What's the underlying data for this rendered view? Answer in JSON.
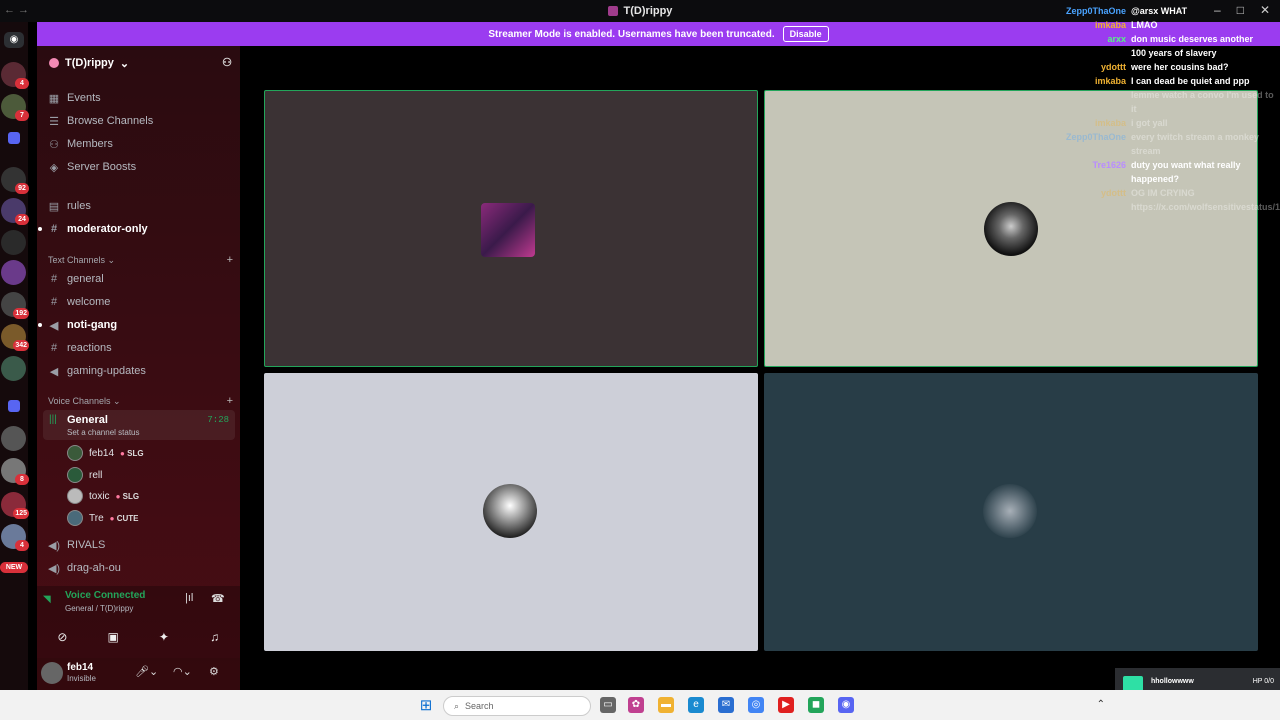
{
  "window": {
    "title": "T(D)rippy",
    "nav": "← →"
  },
  "banner": {
    "text": "Streamer Mode is enabled. Usernames have been truncated.",
    "disable_label": "Disable"
  },
  "guilds": {
    "badges": [
      "4",
      "7",
      "92",
      "24",
      "192",
      "342",
      "8",
      "125",
      "4"
    ],
    "new_label": "NEW"
  },
  "server": {
    "name": "T(D)rippy"
  },
  "nav": [
    {
      "label": "Events",
      "icon": "calendar-icon"
    },
    {
      "label": "Browse Channels",
      "icon": "browse-icon"
    },
    {
      "label": "Members",
      "icon": "members-icon"
    },
    {
      "label": "Server Boosts",
      "icon": "boost-icon"
    }
  ],
  "channels_top": [
    {
      "label": "rules",
      "icon": "#",
      "bold": false
    },
    {
      "label": "moderator-only",
      "icon": "#",
      "bold": true
    }
  ],
  "text_category": {
    "label": "Text Channels"
  },
  "text_channels": [
    {
      "label": "general",
      "icon": "#",
      "bold": false
    },
    {
      "label": "welcome",
      "icon": "#",
      "bold": false
    },
    {
      "label": "noti-gang",
      "icon": "📢",
      "bold": true
    },
    {
      "label": "reactions",
      "icon": "#",
      "bold": false
    },
    {
      "label": "gaming-updates",
      "icon": "📢",
      "bold": false
    }
  ],
  "voice_category": {
    "label": "Voice Channels"
  },
  "voice_general": {
    "name": "General",
    "time": "7:28",
    "status": "Set a channel status"
  },
  "voice_users": [
    {
      "name": "feb14",
      "tag": "SLG"
    },
    {
      "name": "rell",
      "tag": ""
    },
    {
      "name": "toxic",
      "tag": "SLG"
    },
    {
      "name": "Tre",
      "tag": "CUTE"
    }
  ],
  "channels_bottom": [
    {
      "label": "RIVALS",
      "icon": "🔊"
    },
    {
      "label": "drag-ah-ou",
      "icon": "🔊"
    }
  ],
  "voice_panel": {
    "title": "Voice Connected",
    "sub": "General / T(D)rippy"
  },
  "user_panel": {
    "name": "feb14",
    "status": "Invisible"
  },
  "chat": [
    {
      "user": "Zepp0ThaOne",
      "text": "@arsx WHAT",
      "color": "#4aa3ff",
      "faded": false
    },
    {
      "user": "imkaba",
      "text": "LMAO",
      "color": "#f0b232",
      "faded": false
    },
    {
      "user": "arxx",
      "text": "don music deserves another",
      "color": "#57f287",
      "faded": false
    },
    {
      "user": "",
      "text": "100 years of slavery",
      "color": "#ffffff",
      "faded": false
    },
    {
      "user": "ydottt",
      "text": "were her cousins bad?",
      "color": "#f0b232",
      "faded": false
    },
    {
      "user": "imkaba",
      "text": "I can dead be quiet and ppp",
      "color": "#f0b232",
      "faded": false
    },
    {
      "user": "",
      "text": "lemme watch a convo i'm used to it",
      "color": "#ffffff",
      "faded": true
    },
    {
      "user": "imkaba",
      "text": "i got yall",
      "color": "#f0b232",
      "faded": true
    },
    {
      "user": "Zepp0ThaOne",
      "text": "every twitch stream a monkey stream",
      "color": "#4aa3ff",
      "faded": true
    },
    {
      "user": "Tre1626",
      "text": "duty you want what really happened?",
      "color": "#b98cff",
      "faded": false
    },
    {
      "user": "ydottt",
      "text": "OG IM CRYING https://x.com/wolfsensitivestatus/1924297474492887373",
      "color": "#f0b232",
      "faded": true
    }
  ],
  "overlay": {
    "name": "hhollowwww",
    "hp": "HP 0/0",
    "hp_fraction": 0
  },
  "taskbar": {
    "search_placeholder": "Search"
  },
  "colors": {
    "accent": "#9b3cf0",
    "speaking": "#23a55a",
    "badge": "#d9303a"
  }
}
